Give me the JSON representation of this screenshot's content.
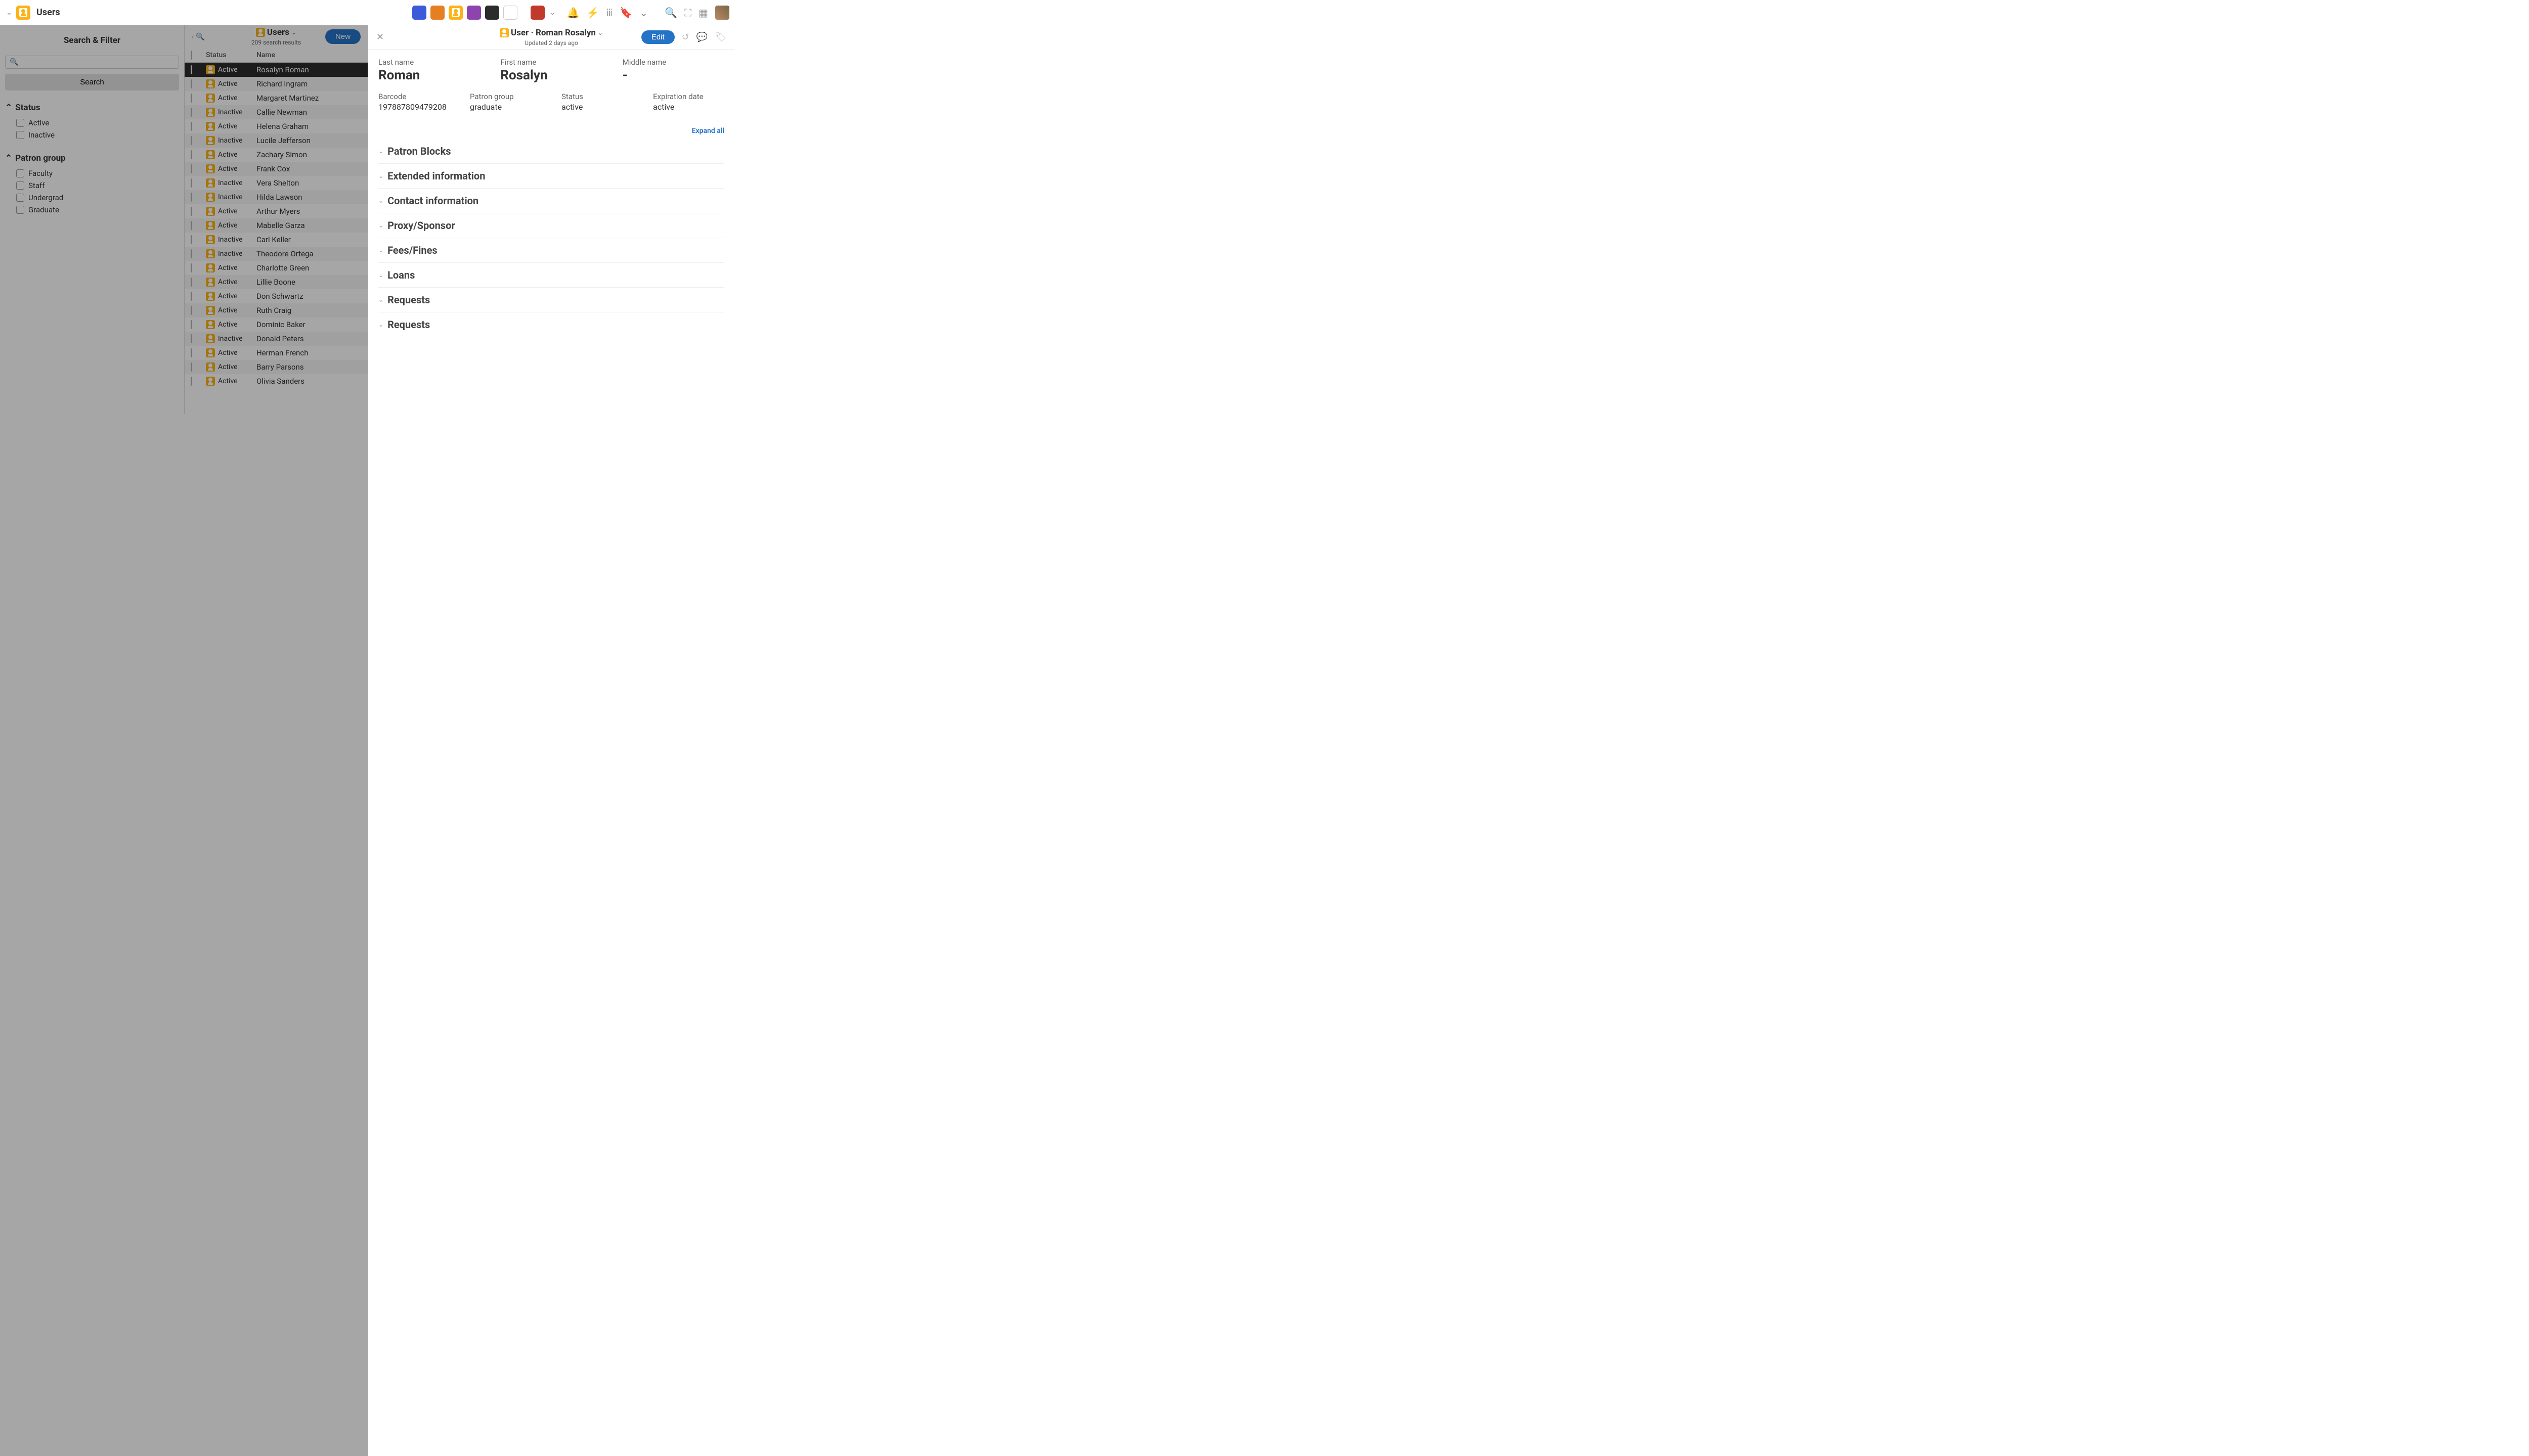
{
  "topbar": {
    "app_title": "Users"
  },
  "sidebar": {
    "title": "Search & Filter",
    "search_button": "Search",
    "status_heading": "Status",
    "status_options": [
      "Active",
      "Inactive"
    ],
    "patron_group_heading": "Patron group",
    "patron_group_options": [
      "Faculty",
      "Staff",
      "Undergrad",
      "Graduate"
    ]
  },
  "center": {
    "title": "Users",
    "results_text": "209 search results",
    "new_button": "New",
    "col_status": "Status",
    "col_name": "Name",
    "rows": [
      {
        "status": "Active",
        "name": "Rosalyn Roman",
        "selected": true
      },
      {
        "status": "Active",
        "name": "Richard Ingram"
      },
      {
        "status": "Active",
        "name": "Margaret Martinez"
      },
      {
        "status": "Inactive",
        "name": "Callie Newman"
      },
      {
        "status": "Active",
        "name": "Helena Graham"
      },
      {
        "status": "Inactive",
        "name": "Lucile Jefferson"
      },
      {
        "status": "Active",
        "name": "Zachary Simon"
      },
      {
        "status": "Active",
        "name": "Frank Cox"
      },
      {
        "status": "Inactive",
        "name": "Vera Shelton"
      },
      {
        "status": "Inactive",
        "name": "Hilda Lawson"
      },
      {
        "status": "Active",
        "name": "Arthur Myers"
      },
      {
        "status": "Active",
        "name": "Mabelle Garza"
      },
      {
        "status": "Inactive",
        "name": "Carl Keller"
      },
      {
        "status": "Inactive",
        "name": "Theodore Ortega"
      },
      {
        "status": "Active",
        "name": "Charlotte Green"
      },
      {
        "status": "Active",
        "name": "Lillie Boone"
      },
      {
        "status": "Active",
        "name": "Don Schwartz"
      },
      {
        "status": "Active",
        "name": "Ruth Craig"
      },
      {
        "status": "Active",
        "name": "Dominic Baker"
      },
      {
        "status": "Inactive",
        "name": "Donald Peters"
      },
      {
        "status": "Active",
        "name": "Herman French"
      },
      {
        "status": "Active",
        "name": "Barry Parsons"
      },
      {
        "status": "Active",
        "name": "Olivia Sanders"
      }
    ]
  },
  "detail": {
    "title": "User · Roman Rosalyn",
    "updated_text": "Updated 2 days ago",
    "edit_button": "Edit",
    "fields1": [
      {
        "label": "Last name",
        "value": "Roman"
      },
      {
        "label": "First name",
        "value": "Rosalyn"
      },
      {
        "label": "Middle name",
        "value": "-"
      }
    ],
    "fields2": [
      {
        "label": "Barcode",
        "value": "197887809479208"
      },
      {
        "label": "Patron group",
        "value": "graduate"
      },
      {
        "label": "Status",
        "value": "active"
      },
      {
        "label": "Expiration date",
        "value": "active"
      }
    ],
    "expand_all": "Expand all",
    "accordions": [
      "Patron Blocks",
      "Extended information",
      "Contact information",
      "Proxy/Sponsor",
      "Fees/Fines",
      "Loans",
      "Requests",
      "Requests"
    ]
  }
}
